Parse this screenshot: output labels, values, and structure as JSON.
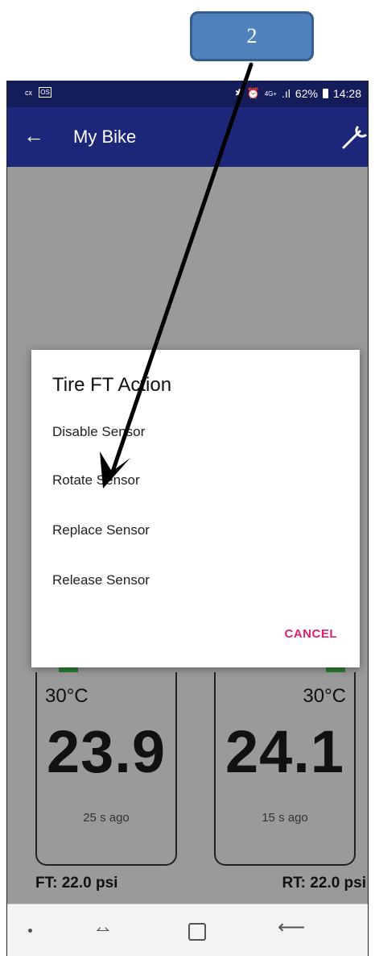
{
  "annotation": {
    "step_number": "2"
  },
  "status_bar": {
    "left_icon_label": "cx",
    "left_chip": "OS",
    "bluetooth_alarm_icons": "✱ ⏰",
    "network": "4G+",
    "signal": ".ıl",
    "battery": "62%",
    "time": "14:28"
  },
  "app_bar": {
    "back_icon": "arrow-left-icon",
    "title": "My Bike",
    "settings_icon": "wrench-icon"
  },
  "dialog": {
    "title": "Tire FT Action",
    "items": [
      {
        "label": "Disable Sensor"
      },
      {
        "label": "Rotate Sensor"
      },
      {
        "label": "Replace Sensor"
      },
      {
        "label": "Release Sensor"
      }
    ],
    "cancel_label": "CANCEL"
  },
  "tires": {
    "front": {
      "temperature": "30°C",
      "pressure": "23.9",
      "last_update": "25 s ago",
      "label": "FT: 22.0 psi"
    },
    "rear": {
      "temperature": "30°C",
      "pressure": "24.1",
      "last_update": "15 s ago",
      "label": "RT: 22.0 psi"
    }
  },
  "colors": {
    "app_bar": "#1c277a",
    "status_bar": "#141c5a",
    "accent": "#e2206b",
    "callout_fill": "#4f81bd",
    "callout_border": "#385d8a"
  }
}
